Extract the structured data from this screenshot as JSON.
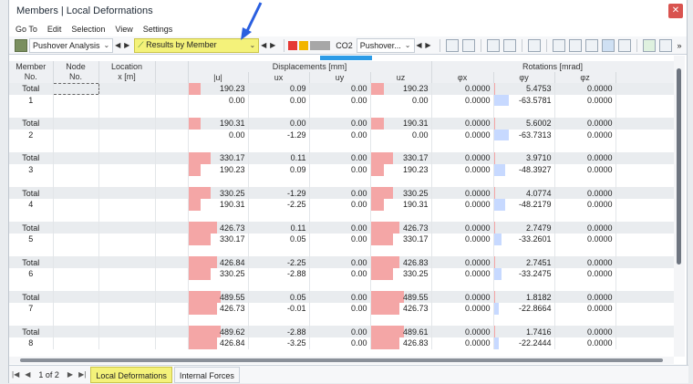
{
  "window": {
    "title": "Members | Local Deformations",
    "close": "✕"
  },
  "menu": [
    "Go To",
    "Edit",
    "Selection",
    "View",
    "Settings"
  ],
  "toolbar": {
    "analysis": "Pushover Analysis",
    "results": "Results by Member",
    "case_code": "CO2",
    "case_name": "Pushover...",
    "colors": [
      "#e53935",
      "#f2b500",
      "#a7a7a7"
    ],
    "accent": "#f4f27a"
  },
  "headers": {
    "member": "Member\nNo.",
    "node": "Node\nNo.",
    "location": "Location\nx [m]",
    "displacements": "Displacements [mm]",
    "rotations": "Rotations [mrad]",
    "cols": [
      "|u|",
      "ux",
      "uy",
      "uz",
      "φx",
      "φy",
      "φz"
    ]
  },
  "rows": [
    {
      "label": "Total",
      "u": "190.23",
      "ux": "0.09",
      "uy": "0.00",
      "uz": "190.23",
      "px": "0.0000",
      "py": "5.4753",
      "pz": "0.0000",
      "total": true
    },
    {
      "label": "1",
      "u": "0.00",
      "ux": "0.00",
      "uy": "0.00",
      "uz": "0.00",
      "px": "0.0000",
      "py": "-63.5781",
      "pz": "0.0000"
    },
    {
      "blank": true
    },
    {
      "label": "Total",
      "u": "190.31",
      "ux": "0.00",
      "uy": "0.00",
      "uz": "190.31",
      "px": "0.0000",
      "py": "5.6002",
      "pz": "0.0000",
      "total": true
    },
    {
      "label": "2",
      "u": "0.00",
      "ux": "-1.29",
      "uy": "0.00",
      "uz": "0.00",
      "px": "0.0000",
      "py": "-63.7313",
      "pz": "0.0000"
    },
    {
      "blank": true
    },
    {
      "label": "Total",
      "u": "330.17",
      "ux": "0.11",
      "uy": "0.00",
      "uz": "330.17",
      "px": "0.0000",
      "py": "3.9710",
      "pz": "0.0000",
      "total": true
    },
    {
      "label": "3",
      "u": "190.23",
      "ux": "0.09",
      "uy": "0.00",
      "uz": "190.23",
      "px": "0.0000",
      "py": "-48.3927",
      "pz": "0.0000"
    },
    {
      "blank": true
    },
    {
      "label": "Total",
      "u": "330.25",
      "ux": "-1.29",
      "uy": "0.00",
      "uz": "330.25",
      "px": "0.0000",
      "py": "4.0774",
      "pz": "0.0000",
      "total": true
    },
    {
      "label": "4",
      "u": "190.31",
      "ux": "-2.25",
      "uy": "0.00",
      "uz": "190.31",
      "px": "0.0000",
      "py": "-48.2179",
      "pz": "0.0000"
    },
    {
      "blank": true
    },
    {
      "label": "Total",
      "u": "426.73",
      "ux": "0.11",
      "uy": "0.00",
      "uz": "426.73",
      "px": "0.0000",
      "py": "2.7479",
      "pz": "0.0000",
      "total": true
    },
    {
      "label": "5",
      "u": "330.17",
      "ux": "0.05",
      "uy": "0.00",
      "uz": "330.17",
      "px": "0.0000",
      "py": "-33.2601",
      "pz": "0.0000"
    },
    {
      "blank": true
    },
    {
      "label": "Total",
      "u": "426.84",
      "ux": "-2.25",
      "uy": "0.00",
      "uz": "426.83",
      "px": "0.0000",
      "py": "2.7451",
      "pz": "0.0000",
      "total": true
    },
    {
      "label": "6",
      "u": "330.25",
      "ux": "-2.88",
      "uy": "0.00",
      "uz": "330.25",
      "px": "0.0000",
      "py": "-33.2475",
      "pz": "0.0000"
    },
    {
      "blank": true
    },
    {
      "label": "Total",
      "u": "489.55",
      "ux": "0.05",
      "uy": "0.00",
      "uz": "489.55",
      "px": "0.0000",
      "py": "1.8182",
      "pz": "0.0000",
      "total": true
    },
    {
      "label": "7",
      "u": "426.73",
      "ux": "-0.01",
      "uy": "0.00",
      "uz": "426.73",
      "px": "0.0000",
      "py": "-22.8664",
      "pz": "0.0000"
    },
    {
      "blank": true
    },
    {
      "label": "Total",
      "u": "489.62",
      "ux": "-2.88",
      "uy": "0.00",
      "uz": "489.61",
      "px": "0.0000",
      "py": "1.7416",
      "pz": "0.0000",
      "total": true
    },
    {
      "label": "8",
      "u": "426.84",
      "ux": "-3.25",
      "uy": "0.00",
      "uz": "426.83",
      "px": "0.0000",
      "py": "-22.2444",
      "pz": "0.0000"
    }
  ],
  "status": {
    "page": "1 of 2",
    "tabs": [
      "Local Deformations",
      "Internal Forces"
    ]
  }
}
